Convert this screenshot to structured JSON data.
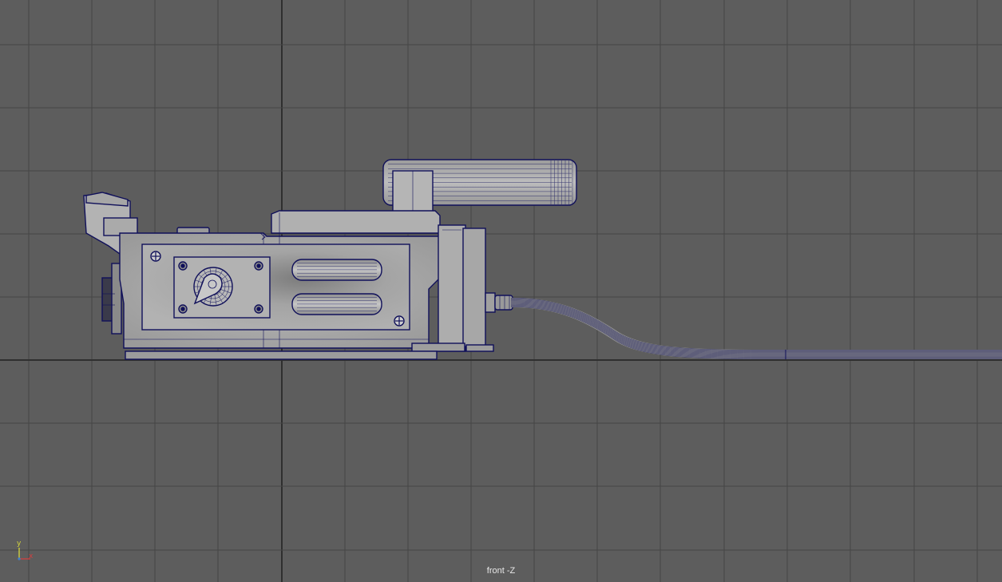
{
  "viewport": {
    "camera_label": "front -Z",
    "background": "#5d5d5d",
    "grid_color": "#454545",
    "origin_line_color": "#2f2f2f",
    "wireframe_color": "#10105a",
    "shading_color": "#a2a2a2"
  },
  "axis_indicator": {
    "y_label": "y",
    "x_label": "x",
    "y_color": "#d6d63c",
    "x_color": "#d04040"
  },
  "model": {
    "object": "camera-rig",
    "parts": [
      "viewfinder",
      "body",
      "control-panel",
      "dial",
      "grip-pads",
      "top-handle",
      "lens-mount",
      "base-plate",
      "cable"
    ]
  }
}
